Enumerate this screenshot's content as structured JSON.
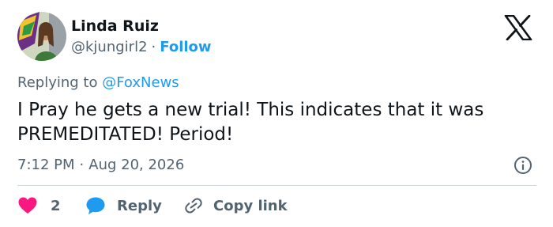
{
  "author": {
    "name": "Linda Ruiz",
    "handle": "@kjungirl2",
    "separator": "·",
    "follow_label": "Follow"
  },
  "replying": {
    "prefix": "Replying to",
    "mention": "@FoxNews"
  },
  "tweet": {
    "text": "I Pray he gets a new trial! This indicates that it was PREMEDITATED! Period!"
  },
  "meta": {
    "time": "7:12 PM",
    "separator": "·",
    "date": "Aug 20, 2026"
  },
  "actions": {
    "like_count": "2",
    "reply_label": "Reply",
    "copy_label": "Copy link"
  },
  "icons": {
    "logo": "x-logo-icon",
    "like": "heart-icon",
    "reply": "speech-bubble-icon",
    "copy": "link-icon",
    "info": "info-icon"
  },
  "colors": {
    "accent": "#1d9bf0",
    "heart": "#f91880",
    "muted": "#536471",
    "text": "#0f1419"
  }
}
